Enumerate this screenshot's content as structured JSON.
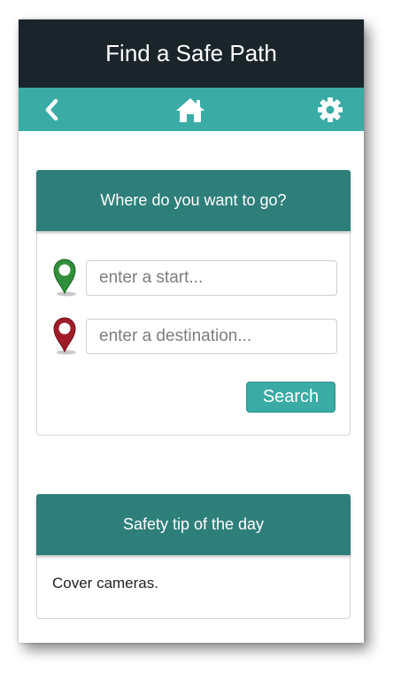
{
  "app": {
    "title": "Find a Safe Path"
  },
  "nav": {
    "back_icon": "chevron-left-icon",
    "home_icon": "home-icon",
    "settings_icon": "gear-icon",
    "background": "#3aaba5"
  },
  "search_card": {
    "header": "Where do you want to go?",
    "start_placeholder": "enter a start...",
    "start_value": "",
    "destination_placeholder": "enter a destination...",
    "destination_value": "",
    "search_label": "Search",
    "start_pin_color": "#2f8f3a",
    "destination_pin_color": "#a01c2a"
  },
  "tip_card": {
    "header": "Safety tip of the day",
    "text": "Cover cameras."
  },
  "colors": {
    "title_bar": "#1a252b",
    "card_header": "#2e7f7a",
    "accent": "#3aaba5"
  }
}
